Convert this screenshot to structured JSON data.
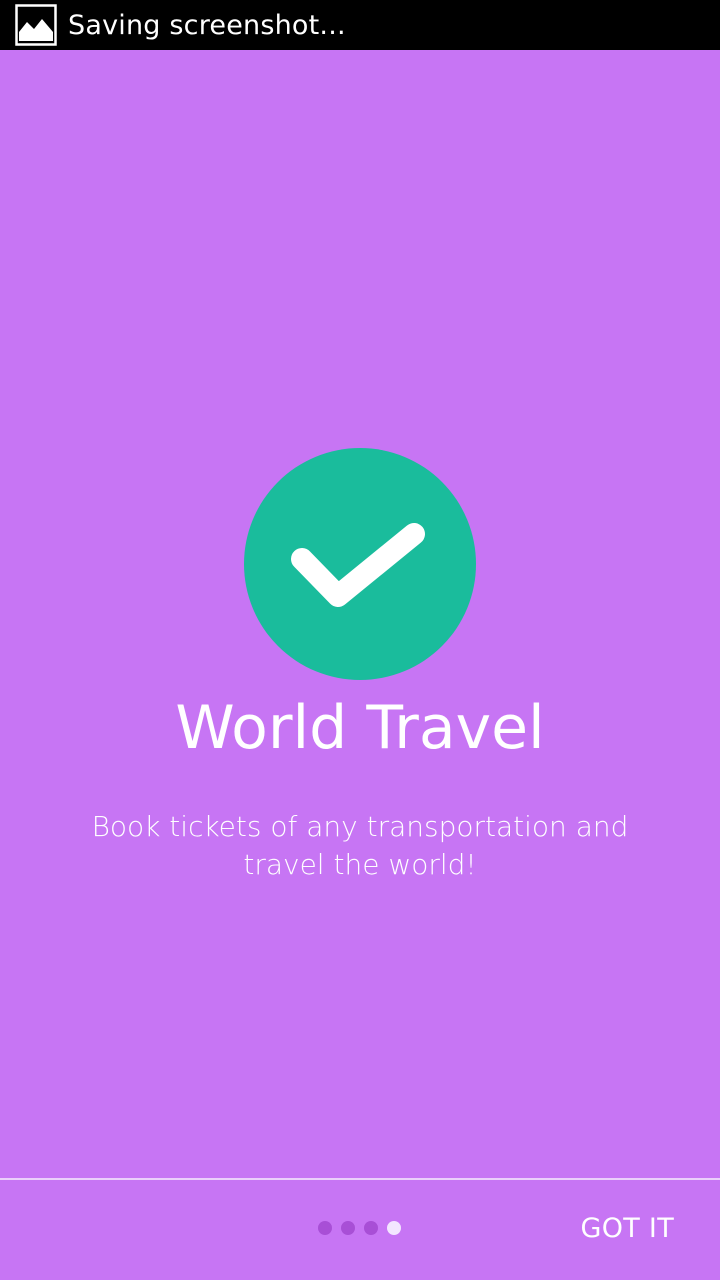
{
  "status_bar": {
    "icon": "image-icon",
    "text": "Saving screenshot..."
  },
  "onboarding": {
    "hero_icon": "checkmark-icon",
    "title": "World Travel",
    "description": "Book tickets of any transportation and travel the world!"
  },
  "pager": {
    "total_pages": 4,
    "current_page": 4
  },
  "actions": {
    "got_it_label": "GOT IT"
  },
  "colors": {
    "background": "#C775F4",
    "status_bar": "#000000",
    "hero_circle": "#1ABC9C",
    "dot_inactive": "#A84FD6",
    "dot_active": "#F3E6FF"
  }
}
